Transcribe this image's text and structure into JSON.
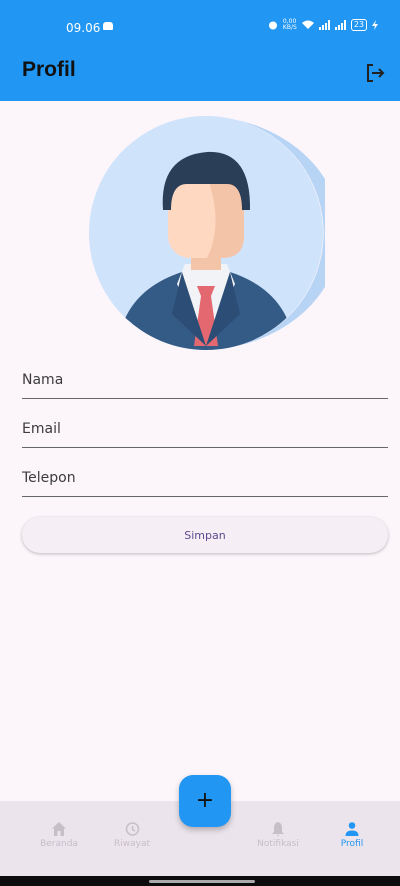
{
  "status_bar": {
    "time": "09.06",
    "net_speed_top": "0,00",
    "net_speed_bottom": "KB/S",
    "battery": "23"
  },
  "app_bar": {
    "title": "Profil",
    "logout_icon": "logout-icon"
  },
  "avatar": {
    "icon": "businessman-avatar"
  },
  "form": {
    "name_placeholder": "Nama",
    "email_placeholder": "Email",
    "phone_placeholder": "Telepon",
    "save_label": "Simpan"
  },
  "fab": {
    "label": "+"
  },
  "bottom_nav": {
    "items": [
      {
        "label": "Beranda",
        "icon": "home-icon"
      },
      {
        "label": "Riwayat",
        "icon": "history-icon"
      },
      {
        "label": "Notifikasi",
        "icon": "bell-icon"
      },
      {
        "label": "Profil",
        "icon": "person-icon"
      }
    ],
    "active": "Profil"
  },
  "colors": {
    "primary": "#2196f3",
    "background": "#fcf6fb",
    "nav_background": "#ebe4ec",
    "button_text": "#5c4a8e"
  }
}
